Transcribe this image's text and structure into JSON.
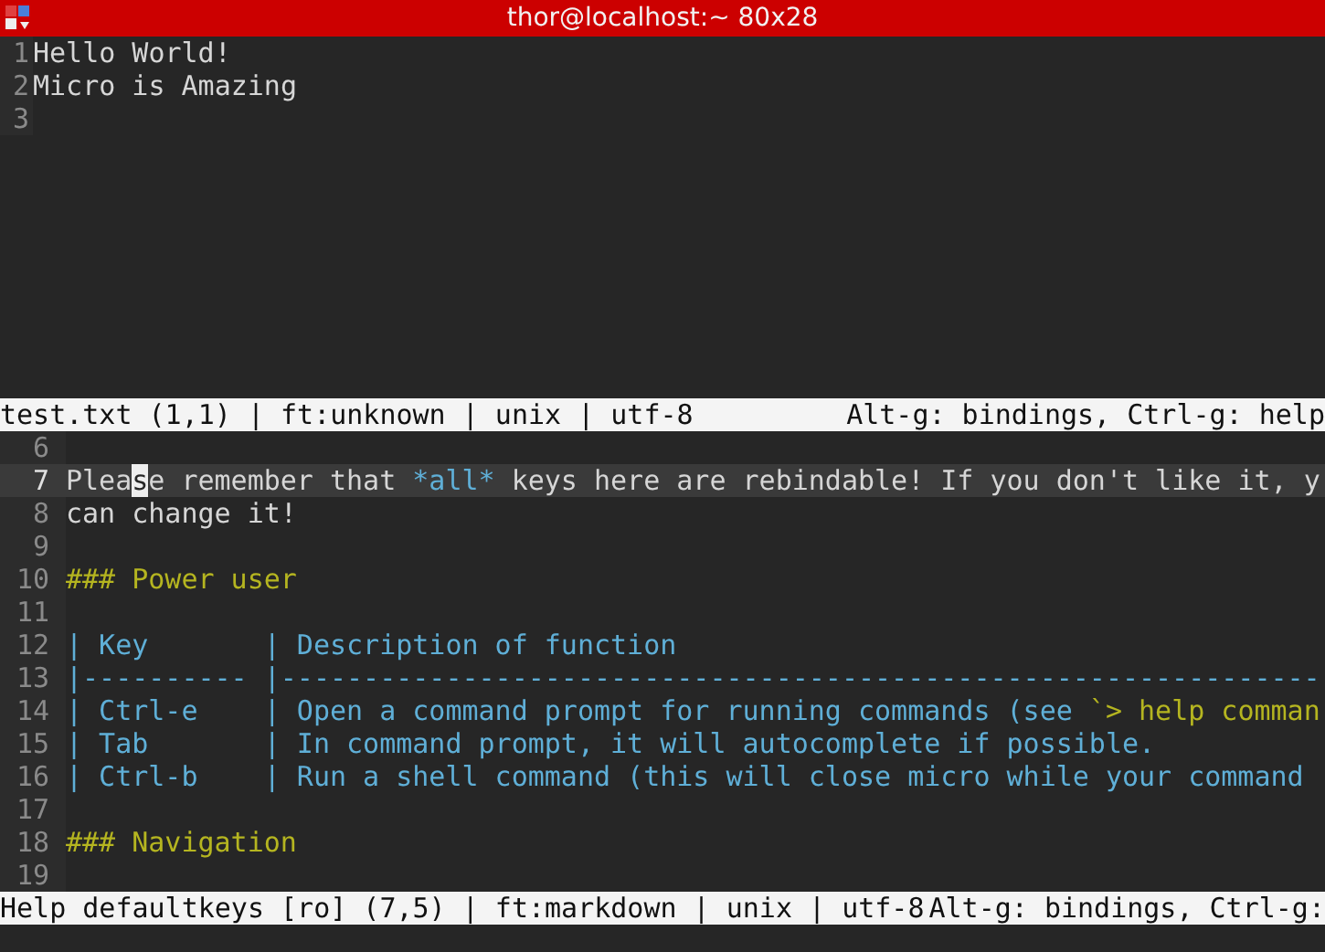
{
  "window": {
    "title": "thor@localhost:~ 80x28"
  },
  "panes": [
    {
      "lines": [
        {
          "number": "1",
          "current": false,
          "segments": [
            {
              "kind": "plain",
              "text": "Hello World!"
            }
          ]
        },
        {
          "number": "2",
          "current": false,
          "segments": [
            {
              "kind": "plain",
              "text": "Micro is Amazing"
            }
          ]
        },
        {
          "number": "3",
          "current": false
        }
      ],
      "status": {
        "left": "test.txt (1,1) | ft:unknown | unix | utf-8",
        "right": "Alt-g: bindings, Ctrl-g: help"
      }
    },
    {
      "lines": [
        {
          "number": "6",
          "current": false
        },
        {
          "number": "7",
          "current": true,
          "segments": [
            {
              "kind": "plain",
              "text": "Plea"
            },
            {
              "kind": "cursor",
              "text": "s"
            },
            {
              "kind": "plain",
              "text": "e remember that "
            },
            {
              "kind": "emphasis",
              "text": "*all*"
            },
            {
              "kind": "plain",
              "text": " keys here are rebindable! If you don't like it, y"
            }
          ]
        },
        {
          "number": "8",
          "current": false,
          "segments": [
            {
              "kind": "plain",
              "text": "can change it!"
            }
          ]
        },
        {
          "number": "9",
          "current": false
        },
        {
          "number": "10",
          "current": false,
          "segments": [
            {
              "kind": "heading",
              "text": "### Power user"
            }
          ]
        },
        {
          "number": "11",
          "current": false
        },
        {
          "number": "12",
          "current": false,
          "segments": [
            {
              "kind": "table",
              "text": "| Key       | Description of function"
            }
          ]
        },
        {
          "number": "13",
          "current": false,
          "segments": [
            {
              "kind": "table",
              "text": "|---------- |---------------------------------------------------------------"
            }
          ]
        },
        {
          "number": "14",
          "current": false,
          "segments": [
            {
              "kind": "table",
              "text": "| Ctrl-e    | Open a command prompt for running commands (see "
            },
            {
              "kind": "code",
              "text": "`> help comman"
            }
          ]
        },
        {
          "number": "15",
          "current": false,
          "segments": [
            {
              "kind": "table",
              "text": "| Tab       | In command prompt, it will autocomplete if possible."
            }
          ]
        },
        {
          "number": "16",
          "current": false,
          "segments": [
            {
              "kind": "table",
              "text": "| Ctrl-b    | Run a shell command (this will close micro while your command"
            }
          ]
        },
        {
          "number": "17",
          "current": false
        },
        {
          "number": "18",
          "current": false,
          "segments": [
            {
              "kind": "heading",
              "text": "### Navigation"
            }
          ]
        },
        {
          "number": "19",
          "current": false
        }
      ],
      "status": {
        "left": "Help defaultkeys [ro] (7,5) | ft:markdown | unix | utf-8",
        "right": "Alt-g: bindings, Ctrl-g:"
      }
    }
  ]
}
